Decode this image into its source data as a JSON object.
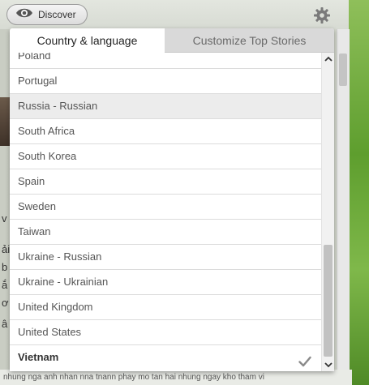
{
  "topbar": {
    "discover_label": "Discover"
  },
  "dialog": {
    "tabs": [
      {
        "label": "Country & language",
        "active": true
      },
      {
        "label": "Customize Top Stories",
        "active": false
      }
    ],
    "countries": [
      {
        "label": "Poland"
      },
      {
        "label": "Portugal"
      },
      {
        "label": "Russia - Russian",
        "highlighted": true
      },
      {
        "label": "South Africa"
      },
      {
        "label": "South Korea"
      },
      {
        "label": "Spain"
      },
      {
        "label": "Sweden"
      },
      {
        "label": "Taiwan"
      },
      {
        "label": "Ukraine - Russian"
      },
      {
        "label": "Ukraine - Ukrainian"
      },
      {
        "label": "United Kingdom"
      },
      {
        "label": "United States"
      },
      {
        "label": "Vietnam",
        "selected": true
      }
    ]
  },
  "background": {
    "left_fragments": [
      "v",
      "ải",
      "b",
      "ắ",
      "ơ",
      "â"
    ],
    "bottom_strip": "nhung nga anh    nhan nna tnann phay mo tan hai nhung ngay kho tham vi"
  },
  "colors": {
    "tab_inactive_bg": "#d9d9d9",
    "row_highlight": "#ececec",
    "divider": "#dcdcdc",
    "accent_green": "#5e9e2e"
  },
  "icons": {
    "discover": "eye-icon",
    "settings": "gear-icon",
    "selected": "checkmark-icon",
    "scroll_up": "chevron-up-icon",
    "scroll_down": "chevron-down-icon"
  }
}
